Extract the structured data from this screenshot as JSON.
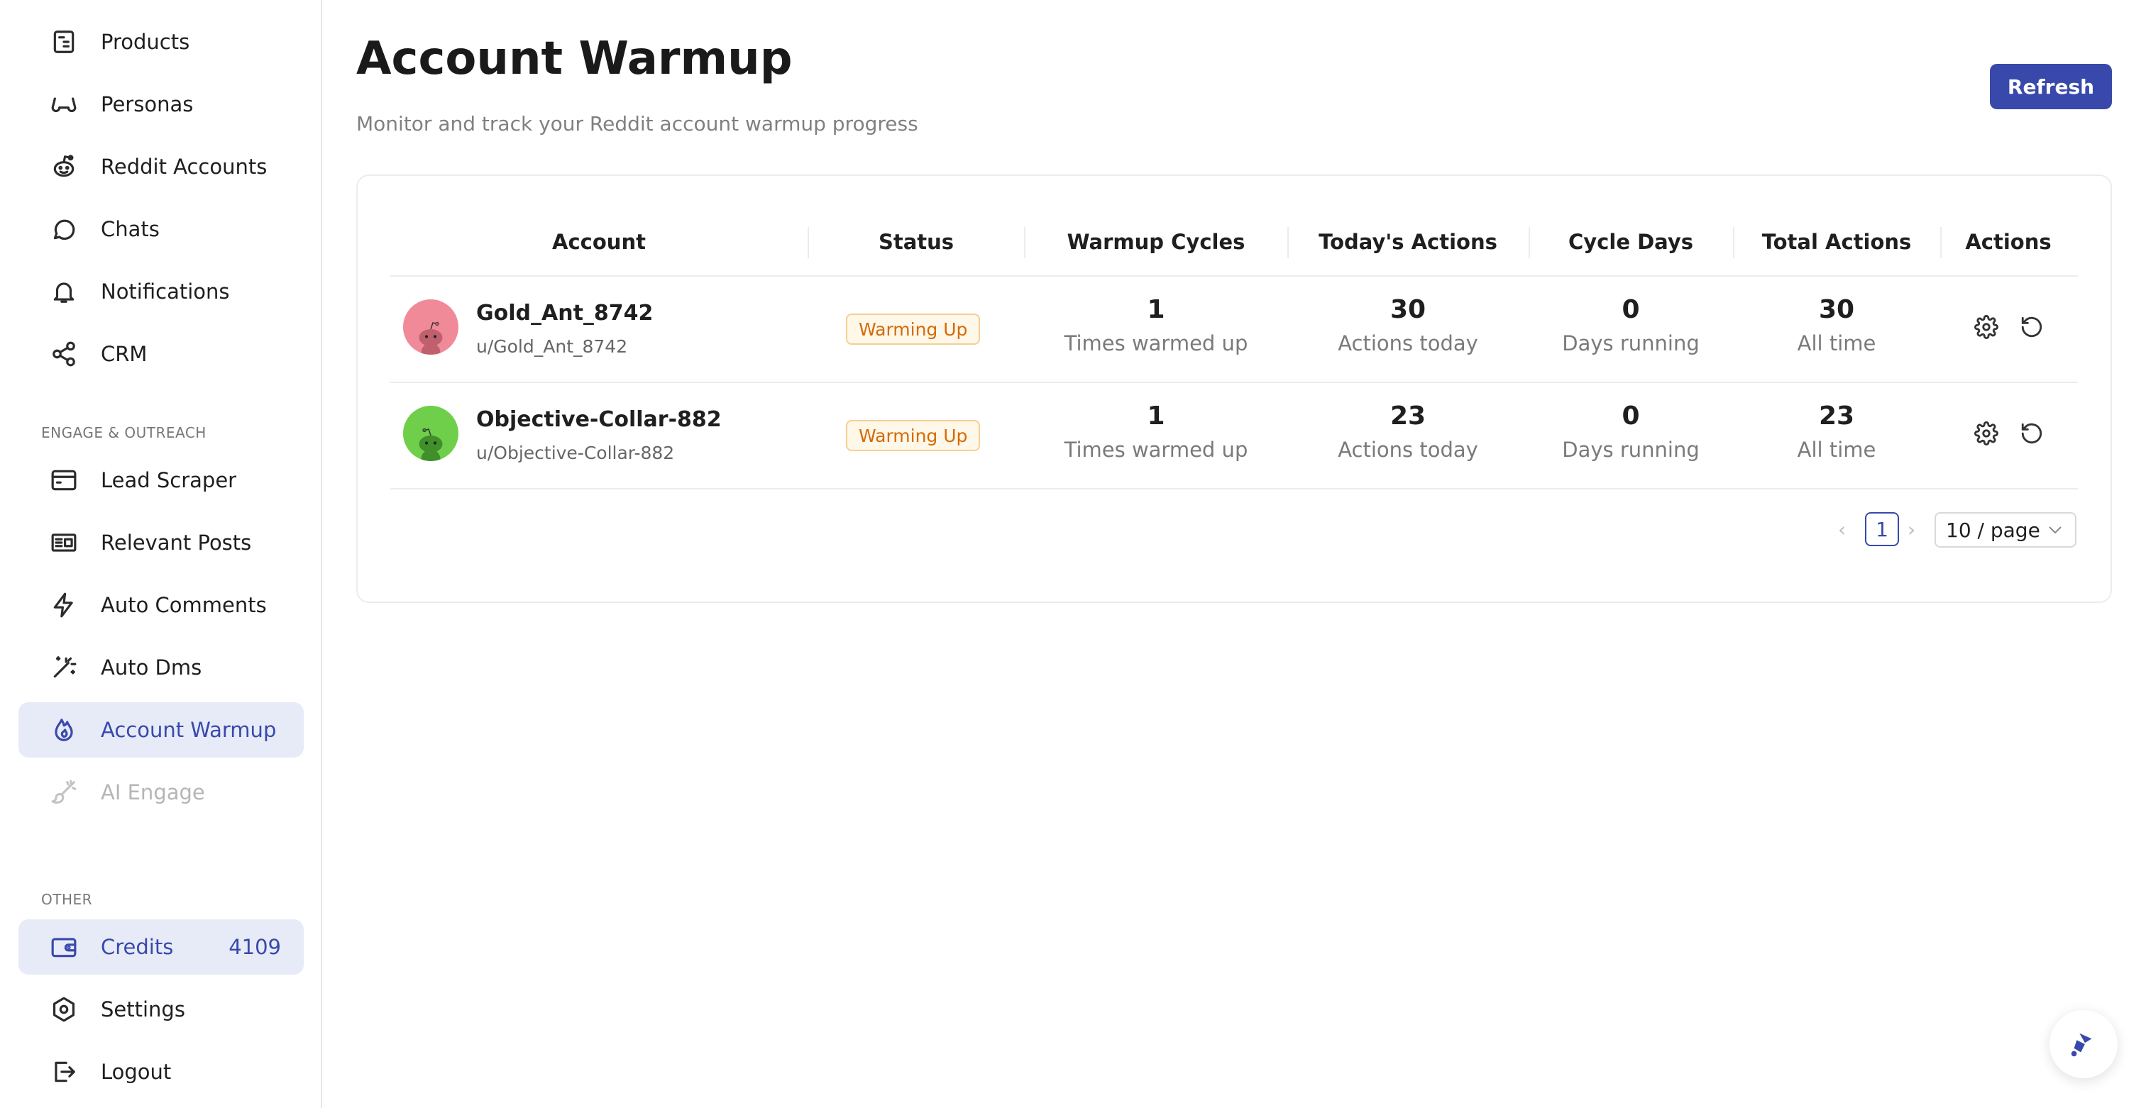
{
  "sidebar": {
    "items": [
      {
        "label": "Products",
        "icon": "product-icon"
      },
      {
        "label": "Personas",
        "icon": "glasses-icon"
      },
      {
        "label": "Reddit Accounts",
        "icon": "reddit-icon"
      },
      {
        "label": "Chats",
        "icon": "chat-bubble-icon"
      },
      {
        "label": "Notifications",
        "icon": "bell-icon"
      },
      {
        "label": "CRM",
        "icon": "share-nodes-icon"
      }
    ],
    "section_engage": "ENGAGE & OUTREACH",
    "engage_items": [
      {
        "label": "Lead Scraper",
        "icon": "browser-window-icon"
      },
      {
        "label": "Relevant Posts",
        "icon": "newspaper-icon"
      },
      {
        "label": "Auto Comments",
        "icon": "lightning-icon"
      },
      {
        "label": "Auto Dms",
        "icon": "magic-wand-icon"
      },
      {
        "label": "Account Warmup",
        "icon": "flame-icon",
        "active": true
      },
      {
        "label": "AI Engage",
        "icon": "brush-icon",
        "disabled": true
      }
    ],
    "section_other": "OTHER",
    "credits": {
      "label": "Credits",
      "value": "4109",
      "icon": "wallet-icon"
    },
    "other_items": [
      {
        "label": "Settings",
        "icon": "hexagon-settings-icon"
      },
      {
        "label": "Logout",
        "icon": "logout-icon"
      }
    ]
  },
  "header": {
    "title": "Account Warmup",
    "subtitle": "Monitor and track your Reddit account warmup progress",
    "refresh_label": "Refresh"
  },
  "table": {
    "columns": [
      "Account",
      "Status",
      "Warmup Cycles",
      "Today's Actions",
      "Cycle Days",
      "Total Actions",
      "Actions"
    ],
    "rows": [
      {
        "name": "Gold_Ant_8742",
        "handle": "u/Gold_Ant_8742",
        "avatar_color": "#f08a99",
        "status": "Warming Up",
        "cycles": "1",
        "cycles_sub": "Times warmed up",
        "today": "30",
        "today_sub": "Actions today",
        "days": "0",
        "days_sub": "Days running",
        "total": "30",
        "total_sub": "All time"
      },
      {
        "name": "Objective-Collar-882",
        "handle": "u/Objective-Collar-882",
        "avatar_color": "#6fcf4a",
        "status": "Warming Up",
        "cycles": "1",
        "cycles_sub": "Times warmed up",
        "today": "23",
        "today_sub": "Actions today",
        "days": "0",
        "days_sub": "Days running",
        "total": "23",
        "total_sub": "All time"
      }
    ]
  },
  "pagination": {
    "current_page": "1",
    "page_size": "10 / page"
  },
  "colors": {
    "accent": "#3949ab",
    "active_bg": "#e6ebf7",
    "badge_text": "#d46b08",
    "badge_bg": "#fff7e8"
  }
}
